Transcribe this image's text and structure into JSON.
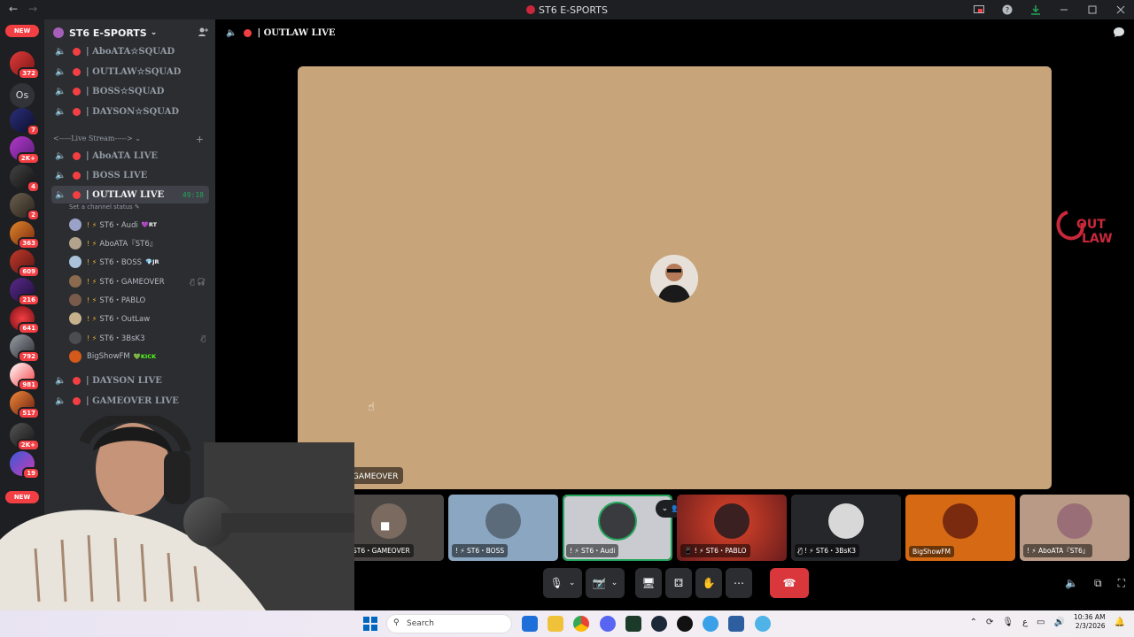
{
  "window": {
    "title": "ST6 E-SPORTS",
    "back_glyph": "←",
    "forward_glyph": "→"
  },
  "rail": {
    "new_label": "NEW",
    "os_label": "Os",
    "badges": [
      "372",
      "7",
      "2K+",
      "4",
      "2",
      "363",
      "609",
      "216",
      "641",
      "792",
      "981",
      "517",
      "2K+",
      "19"
    ]
  },
  "guild": {
    "name": "ST6 E-SPORTS",
    "chevron": "⌄"
  },
  "channels_top": [
    {
      "label": "| AboATA☆SQUAD"
    },
    {
      "label": "| OUTLAW☆SQUAD"
    },
    {
      "label": "| BOSS☆SQUAD"
    },
    {
      "label": "| DAYSON☆SQUAD"
    }
  ],
  "category": {
    "label": "<-----Live Stream-----> ⌄"
  },
  "channels_live": [
    {
      "label": "| AboATA LIVE"
    },
    {
      "label": "| BOSS LIVE"
    },
    {
      "label": "| OUTLAW LIVE",
      "timer": "49:18"
    }
  ],
  "channel_status": "Set a channel status ✎",
  "members": [
    {
      "prefix": "! ⚡",
      "name": "ST6・Audi",
      "tag": "💜RT",
      "color": "#9aa3c7"
    },
    {
      "prefix": "! ⚡",
      "name": "AboATA『ST6』",
      "tag": "",
      "color": "#b3a38c"
    },
    {
      "prefix": "! ⚡",
      "name": "ST6・BOSS",
      "tag": "💎JR",
      "color": "#a9c1d9"
    },
    {
      "prefix": "! ⚡",
      "name": "ST6・GAMEOVER",
      "tag": "",
      "color": "#8b6a4e",
      "mic": "🎙̸ 🎧̸"
    },
    {
      "prefix": "! ⚡",
      "name": "ST6・PABLO",
      "tag": "",
      "color": "#7a5b4b"
    },
    {
      "prefix": "! ⚡",
      "name": "ST6・OutLaw",
      "tag": "",
      "color": "#c7b18c"
    },
    {
      "prefix": "! ⚡",
      "name": "ST6・3BsK3",
      "tag": "",
      "color": "#4b4d52",
      "mic": "🎙̸"
    },
    {
      "prefix": "",
      "name": "BigShowFM",
      "tag": "💚KICK",
      "color": "#d35a1a"
    }
  ],
  "channels_after": [
    {
      "label": "| DAYSON LIVE"
    },
    {
      "label": "| GAMEOVER LIVE"
    }
  ],
  "main": {
    "channel_title": "| OUTLAW LIVE",
    "stage_label": "🎙̸ ! ⚡ ST6・GAMEOVER",
    "logo_text": "OUT LAW"
  },
  "tiles": [
    {
      "label": "",
      "bg": "#3a3b3f"
    },
    {
      "label": "! ⚡ ST6・GAMEOVER",
      "bg": "#4a4644"
    },
    {
      "label": "! ⚡ ST6・BOSS",
      "bg": "#8aa6c1"
    },
    {
      "label": "! ⚡ ST6・Audi",
      "bg": "#c9cbd1"
    },
    {
      "label": "📱 ! ⚡ ST6・PABLO",
      "bg": "#6a1d1d"
    },
    {
      "label": "🎙̸ ! ⚡ ST6・3BsK3",
      "bg": "#26272a"
    },
    {
      "label": "BigShowFM",
      "bg": "#d66a14"
    },
    {
      "label": "! ⚡ AboATA『ST6』",
      "bg": "#b89a86"
    }
  ],
  "controls": {
    "mic": "🎙",
    "camera": "📷̸",
    "screen": "🖥",
    "activities": "⚃",
    "soundboard": "✋",
    "more": "⋯",
    "hangup": "☎"
  },
  "taskbar": {
    "search_placeholder": "Search",
    "time": "10:36 AM",
    "date": "2/3/2026",
    "lang": "ع"
  },
  "colors": {
    "danger": "#f23f43",
    "success": "#23a55a",
    "stage_bg": "#c8a47a"
  }
}
